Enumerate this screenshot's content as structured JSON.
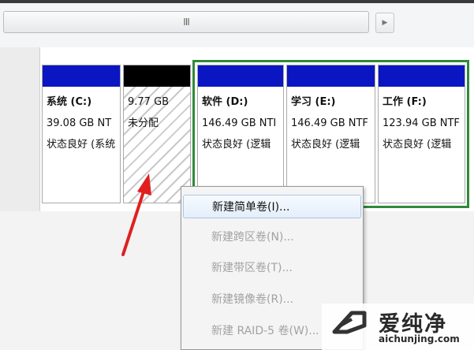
{
  "scrollbar": {
    "thumb_grip": "III",
    "right_arrow": "▶"
  },
  "partitions": [
    {
      "name": "系统 (C:)",
      "size": "39.08 GB NT",
      "status": "状态良好 (系统",
      "header_color": "#0a16c2"
    },
    {
      "name": "",
      "size": "9.77 GB",
      "status": "未分配",
      "header_color": "#000000"
    },
    {
      "name": "软件 (D:)",
      "size": "146.49 GB NTI",
      "status": "状态良好 (逻辑",
      "header_color": "#0a16c2"
    },
    {
      "name": "学习 (E:)",
      "size": "146.49 GB NTF",
      "status": "状态良好 (逻辑",
      "header_color": "#0a16c2"
    },
    {
      "name": "工作 (F:)",
      "size": "123.94 GB NTF",
      "status": "状态良好 (逻辑",
      "header_color": "#0a16c2"
    }
  ],
  "context_menu": {
    "items": [
      {
        "label": "新建简单卷(I)...",
        "enabled": true
      },
      {
        "label": "新建跨区卷(N)...",
        "enabled": false
      },
      {
        "label": "新建带区卷(T)...",
        "enabled": false
      },
      {
        "label": "新建镜像卷(R)...",
        "enabled": false
      },
      {
        "label": "新建 RAID-5 卷(W)...",
        "enabled": false
      }
    ]
  },
  "annotation": {
    "arrow_color": "#e02020"
  },
  "watermark": {
    "text": "爱纯净",
    "url": "aichunjing.com"
  },
  "colors": {
    "extended_partition_frame": "#2f8a3a",
    "primary_header": "#0a16c2"
  }
}
